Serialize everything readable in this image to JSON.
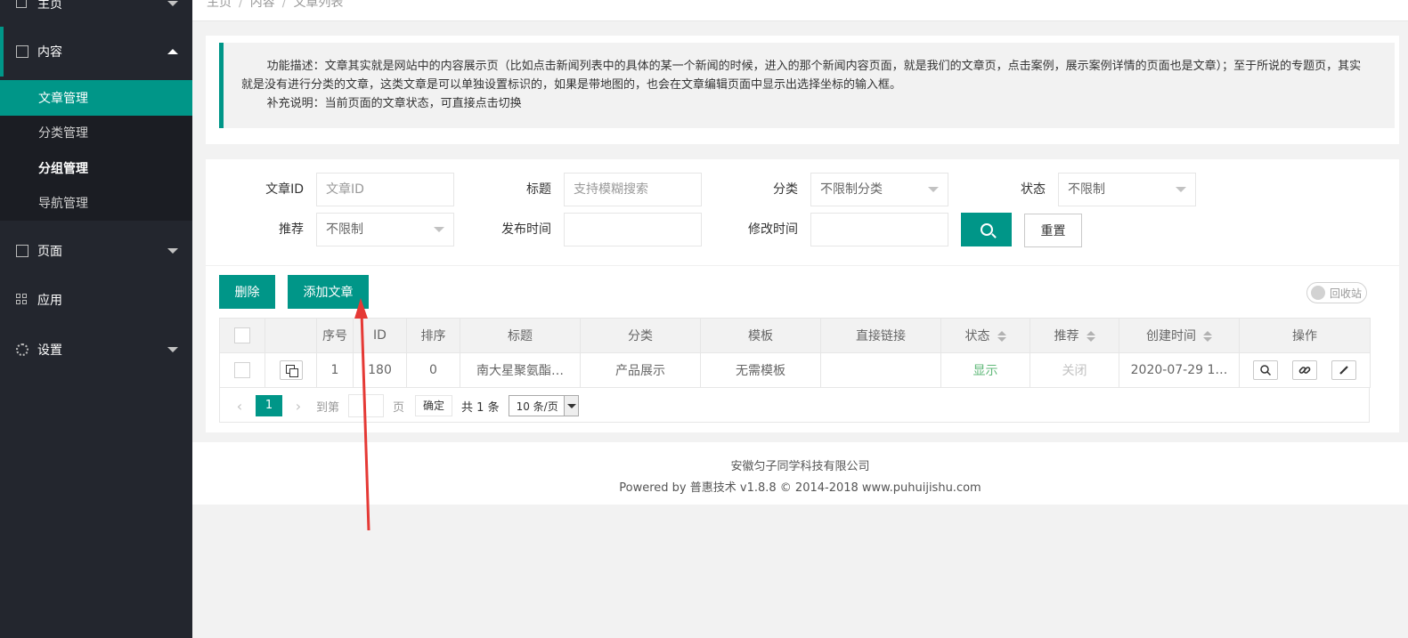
{
  "sidebar": {
    "home_label": "主页",
    "content_label": "内容",
    "sub_items": [
      "文章管理",
      "分类管理",
      "分组管理",
      "导航管理"
    ],
    "page_label": "页面",
    "app_label": "应用",
    "settings_label": "设置"
  },
  "breadcrumb": {
    "items": [
      "主页",
      "内容",
      "文章列表"
    ]
  },
  "description": {
    "line1": "功能描述：文章其实就是网站中的内容展示页（比如点击新闻列表中的具体的某一个新闻的时候，进入的那个新闻内容页面，就是我们的文章页，点击案例，展示案例详情的页面也是文章）；至于所说的专题页，其实就是没有进行分类的文章，这类文章是可以单独设置标识的，如果是带地图的，也会在文章编辑页面中显示出选择坐标的输入框。",
    "line2": "补充说明：当前页面的文章状态，可直接点击切换"
  },
  "filters": {
    "article_id_label": "文章ID",
    "article_id_placeholder": "文章ID",
    "title_label": "标题",
    "title_placeholder": "支持模糊搜索",
    "category_label": "分类",
    "category_value": "不限制分类",
    "status_label": "状态",
    "status_value": "不限制",
    "recommend_label": "推荐",
    "recommend_value": "不限制",
    "publish_time_label": "发布时间",
    "modify_time_label": "修改时间",
    "reset_label": "重置"
  },
  "actions": {
    "delete_label": "删除",
    "add_label": "添加文章",
    "recycle_label": "回收站"
  },
  "table": {
    "headers": [
      "序号",
      "ID",
      "排序",
      "标题",
      "分类",
      "模板",
      "直接链接",
      "状态",
      "推荐",
      "创建时间",
      "操作"
    ],
    "rows": [
      {
        "index": "1",
        "id": "180",
        "sort": "0",
        "title": "南大星聚氨酯…",
        "category": "产品展示",
        "template": "无需模板",
        "link": "",
        "status": "显示",
        "recommend": "关闭",
        "created": "2020-07-29 1…"
      }
    ]
  },
  "pager": {
    "current": "1",
    "goto_label": "到第",
    "page_unit": "页",
    "confirm_label": "确定",
    "total_label": "共 1 条",
    "page_size": "10 条/页"
  },
  "footer": {
    "company": "安徽匀子同学科技有限公司",
    "powered": "Powered by 普惠技术 v1.8.8 © 2014-2018 www.puhuijishu.com"
  },
  "colors": {
    "accent": "#009688",
    "sidebar_bg": "#23262e",
    "annotation": "#e53935"
  }
}
